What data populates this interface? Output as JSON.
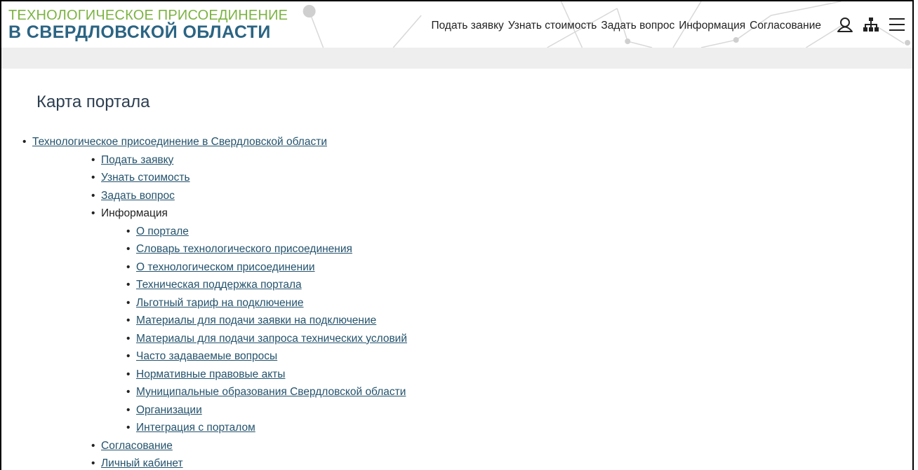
{
  "logo": {
    "top_line": "ТЕХНОЛОГИЧЕСКОЕ ПРИСОЕДИНЕНИЕ",
    "bottom_line": "В СВЕРДЛОВСКОЙ ОБЛАСТИ"
  },
  "topnav": {
    "items": [
      {
        "label": "Подать заявку"
      },
      {
        "label": "Узнать стоимость"
      },
      {
        "label": "Задать вопрос"
      },
      {
        "label": "Информация"
      },
      {
        "label": "Согласование"
      }
    ]
  },
  "header_icons": [
    "user-icon",
    "sitemap-icon",
    "menu-icon"
  ],
  "colors": {
    "logo_top": "#7cb342",
    "logo_bottom": "#2b6483",
    "link": "#24536d",
    "band": "#eeeeee"
  },
  "page": {
    "title": "Карта портала"
  },
  "sitemap": {
    "root": "Технологическое присоединение в Свердловской области",
    "level2": [
      {
        "label": "Подать заявку"
      },
      {
        "label": "Узнать стоимость"
      },
      {
        "label": "Задать вопрос"
      },
      {
        "label": "Информация"
      },
      {
        "label": "Согласование"
      },
      {
        "label": "Личный кабинет"
      }
    ],
    "info_children": [
      {
        "label": "О портале"
      },
      {
        "label": "Словарь технологического присоединения"
      },
      {
        "label": "О технологическом присоединении"
      },
      {
        "label": "Техническая поддержка портала"
      },
      {
        "label": "Льготный тариф на подключение"
      },
      {
        "label": "Материалы для подачи заявки на подключение"
      },
      {
        "label": "Материалы для подачи запроса технических условий"
      },
      {
        "label": "Часто задаваемые вопросы"
      },
      {
        "label": "Нормативные правовые акты"
      },
      {
        "label": "Муниципальные образования Свердловской области"
      },
      {
        "label": "Организации"
      },
      {
        "label": "Интеграция с порталом"
      }
    ]
  }
}
